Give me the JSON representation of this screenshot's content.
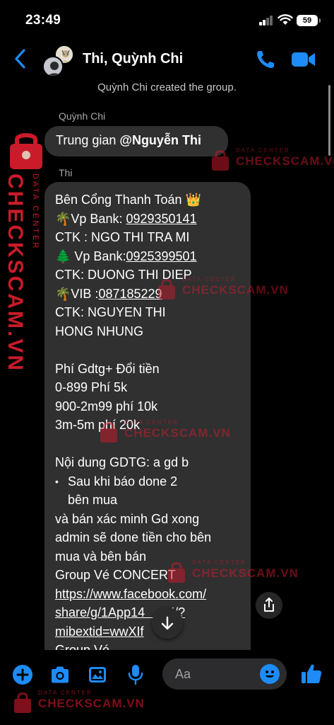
{
  "status_bar": {
    "time": "23:49",
    "battery": "59"
  },
  "header": {
    "title": "Thi, Quỳnh Chi"
  },
  "system_message": "Quỳnh Chi created the group.",
  "messages": [
    {
      "sender": "Quỳnh Chi",
      "text": "Trung gian ",
      "mention": "@Nguyễn Thi"
    },
    {
      "sender": "Thi",
      "lines": {
        "l1": "Bên Cổng Thanh Toán 👑",
        "l2_prefix": "🌴Vp Bank: ",
        "l2_link": "0929350141",
        "l3": "CTK : NGO THI TRA MI",
        "l4_prefix": "🌲 Vp Bank:",
        "l4_link": "0925399501",
        "l5": "CTK: DUONG THI DIEP",
        "l6_prefix": "🌴VIB :",
        "l6_link": "087185229",
        "l7": "CTK: NGUYEN THI",
        "l8": "HONG NHUNG",
        "l9": "Phí Gdtg+ Đổi tiền",
        "l10": "0-899 Phí 5k",
        "l11": "900-2m99 phí 10k",
        "l12": "3m-5m phí 20k",
        "l13": "Nội dung GDTG: a gd b",
        "bullet_1": "Sau khi báo done 2",
        "bullet_2": "bên mua",
        "l14": "và bán xác minh Gd xong",
        "l15": "admin sẽ done tiền cho bên",
        "l16": "mua và bên bán",
        "l17": "Group Vé CONCERT",
        "link_1": "https://www.facebook.com/",
        "link_2": "share/g/1App14      K/?",
        "link_3": "mibextid=wwXIf",
        "l18": "Group Vé"
      }
    }
  ],
  "composer": {
    "placeholder": "Aa"
  },
  "watermark": {
    "small": "DATA CENTER",
    "big": "CHECKSCAM.VN"
  },
  "colors": {
    "accent": "#1d8cf8",
    "bubble": "#303030",
    "watermark": "#d41a2c"
  }
}
